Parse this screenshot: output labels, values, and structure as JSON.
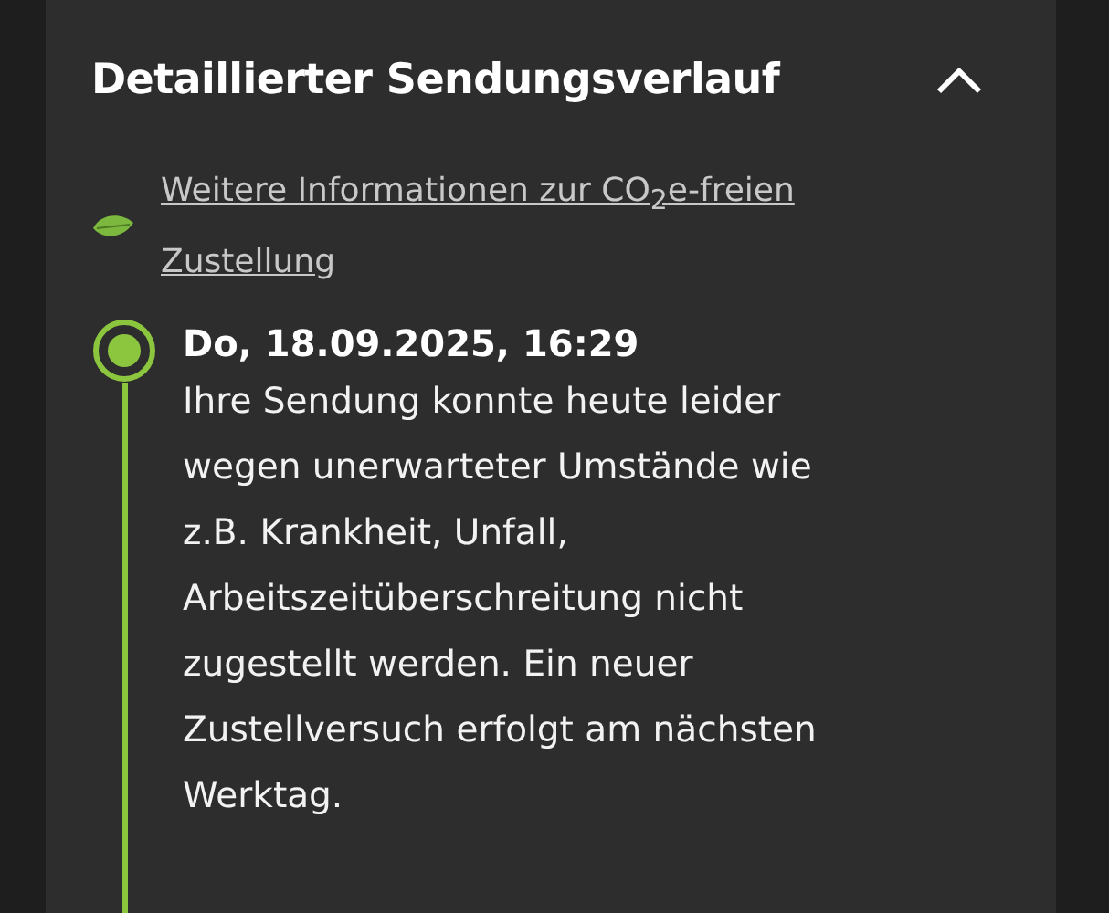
{
  "section": {
    "title": "Detaillierter Sendungsverlauf",
    "expanded": true
  },
  "info_link": {
    "lines": [
      "Weitere Informationen zur CO$_{2}$e-freien",
      "Zustellung"
    ]
  },
  "events": [
    {
      "date": "Do, 18.09.2025, 16:29",
      "current": true,
      "lines": [
        "Ihre Sendung konnte heute leider",
        "wegen unerwarteter Umstände wie",
        "z.B. Krankheit, Unfall,",
        "Arbeitszeitüberschreitung nicht",
        "zugestellt werden. Ein neuer",
        "Zustellversuch erfolgt am nächsten",
        "Werktag."
      ]
    }
  ]
}
